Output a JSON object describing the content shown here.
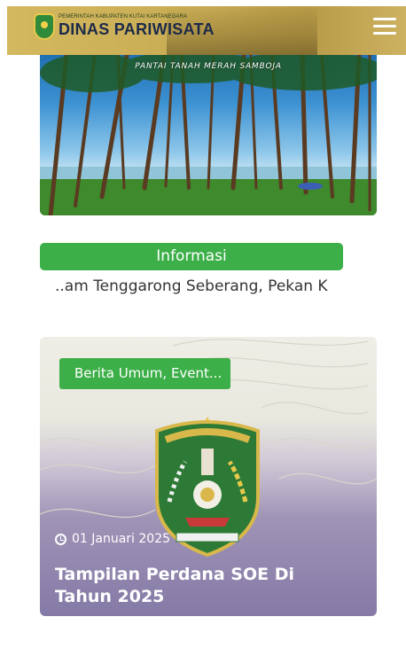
{
  "header": {
    "logo_small_text": "PEMERINTAH KABUPATEN KUTAI KARTANEGARA",
    "logo_text": "DINAS PARIWISATA",
    "menu_icon": "hamburger-menu-icon",
    "background_color": "#c9ad55"
  },
  "hero": {
    "caption": "PANTAI TANAH MERAH SAMBOJA"
  },
  "info": {
    "button_label": "Informasi",
    "ticker_text": "..am Tenggarong Seberang, Pekan Kr..."
  },
  "news_card": {
    "category": "Berita Umum, Event...",
    "date": "01 Januari 2025",
    "date_icon": "clock-icon",
    "title": "Tampilan Perdana SOE Di Tahun 2025",
    "emblem_icon": "kabupaten-kutai-kartanegara-emblem"
  },
  "colors": {
    "accent_green": "#3daf48",
    "card_purple": "#857aa6",
    "header_gold": "#c9ad55"
  }
}
